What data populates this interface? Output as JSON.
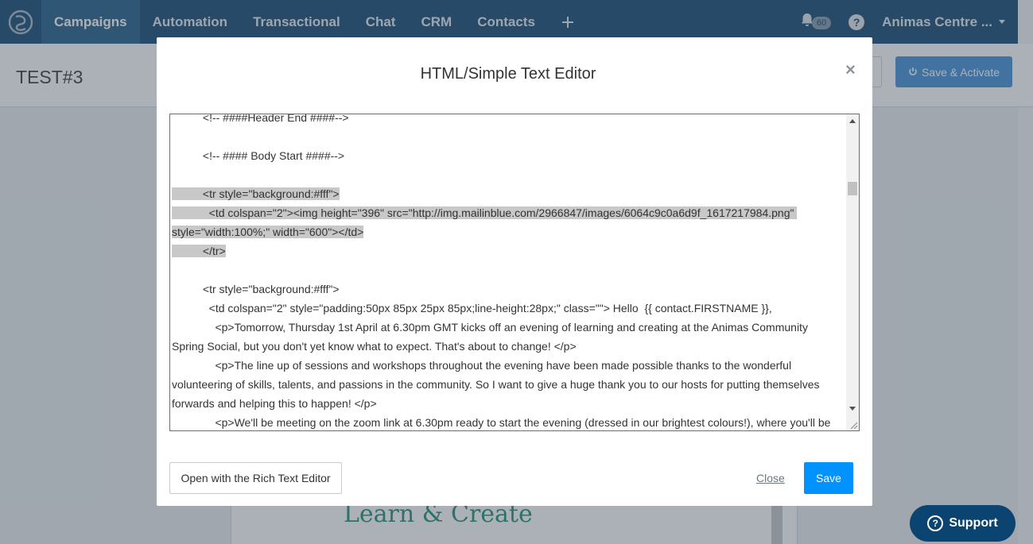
{
  "nav": {
    "items": [
      {
        "label": "Campaigns",
        "active": true
      },
      {
        "label": "Automation",
        "active": false
      },
      {
        "label": "Transactional",
        "active": false
      },
      {
        "label": "Chat",
        "active": false
      },
      {
        "label": "CRM",
        "active": false
      },
      {
        "label": "Contacts",
        "active": false
      }
    ],
    "plus_label": "+",
    "notifications_count": "60",
    "help_label": "?",
    "account_name": "Animas Centre ..."
  },
  "page": {
    "title": "TEST#3",
    "save_activate_label": "Save & Activate",
    "preview_heading": "Learn & Create"
  },
  "modal": {
    "title": "HTML/Simple Text Editor",
    "close_icon": "×",
    "editor_lines": [
      {
        "text": "          <!-- ####Header End ####-->",
        "selected": false
      },
      {
        "text": "",
        "selected": false
      },
      {
        "text": "          <!-- #### Body Start ####-->",
        "selected": false
      },
      {
        "text": "",
        "selected": false
      },
      {
        "text": "          <tr style=\"background:#fff\">",
        "selected": true
      },
      {
        "text": "            <td colspan=\"2\"><img height=\"396\" src=\"http://img.mailinblue.com/2966847/images/6064c9c0a6d9f_1617217984.png\" ",
        "selected": true
      },
      {
        "text": "style=\"width:100%;\" width=\"600\"></td>",
        "selected": true
      },
      {
        "text": "          </tr>",
        "selected": true
      },
      {
        "text": "",
        "selected": false
      },
      {
        "text": "          <tr style=\"background:#fff\">",
        "selected": false
      },
      {
        "text": "            <td colspan=\"2\" style=\"padding:50px 85px 25px 85px;line-height:28px;\" class=\"\"> Hello  {{ contact.FIRSTNAME }},",
        "selected": false
      },
      {
        "text": "              <p>Tomorrow, Thursday 1st April at 6.30pm GMT kicks off an evening of learning and creating at the Animas Community",
        "selected": false
      },
      {
        "text": "Spring Social, but you don't yet know what to expect. That's about to change! </p>",
        "selected": false
      },
      {
        "text": "              <p>The line up of sessions and workshops throughout the evening have been made possible thanks to the wonderful",
        "selected": false
      },
      {
        "text": "volunteering of skills, talents, and passions in the community. So I want to give a huge thank you to our hosts for putting themselves",
        "selected": false
      },
      {
        "text": "forwards and helping this to happen! </p>",
        "selected": false
      },
      {
        "text": "              <p>We'll be meeting on the zoom link at 6.30pm ready to start the evening (dressed in our brightest colours!), where you'll be",
        "selected": false
      }
    ],
    "rich_text_button": "Open with the Rich Text Editor",
    "close_link": "Close",
    "save_button": "Save"
  },
  "support": {
    "label": "Support",
    "icon": "?"
  },
  "colors": {
    "nav_bg": "#0b4470",
    "nav_active": "#1e5a87",
    "primary": "#0092ff",
    "activate": "#3f8fd6",
    "selection": "#c8c8c8",
    "heading_green": "#1d8a74"
  },
  "icons": [
    "logo-icon",
    "plus-icon",
    "bell-icon",
    "help-icon",
    "caret-down-icon",
    "power-icon",
    "close-icon",
    "support-icon"
  ]
}
